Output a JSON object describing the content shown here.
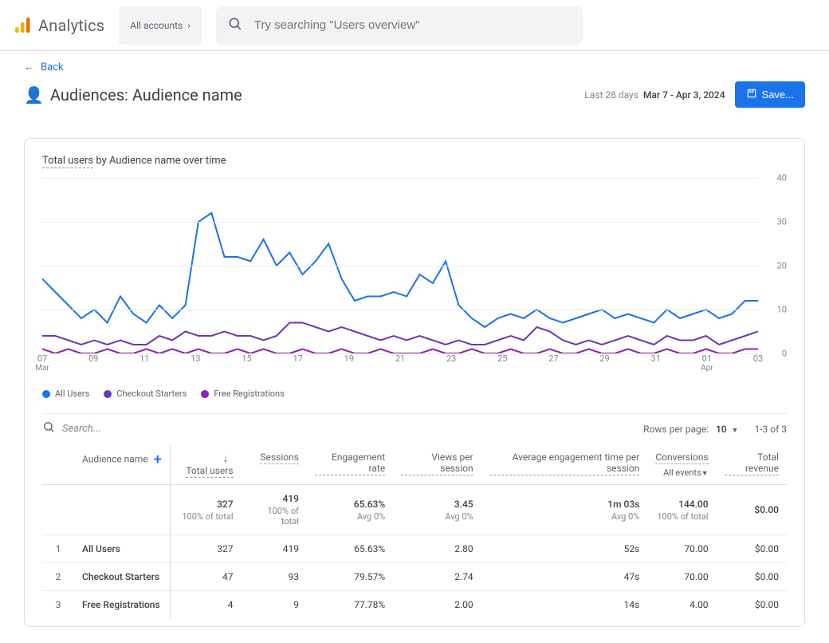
{
  "header": {
    "product": "Analytics",
    "account_chip": "All accounts",
    "search_placeholder": "Try searching \"Users overview\""
  },
  "nav": {
    "back_label": "Back"
  },
  "page": {
    "title": "Audiences: Audience name",
    "date_prefix": "Last 28 days",
    "date_range": "Mar 7 - Apr 3, 2024",
    "save_label": "Save..."
  },
  "card": {
    "title_a": "Total users",
    "title_b": " by Audience name over time"
  },
  "chart_data": {
    "type": "line",
    "ylim": [
      0,
      40
    ],
    "y_ticks": [
      0,
      10,
      20,
      30,
      40
    ],
    "x_ticks": [
      "07",
      "09",
      "11",
      "13",
      "15",
      "17",
      "19",
      "21",
      "23",
      "25",
      "27",
      "29",
      "31",
      "01",
      "03"
    ],
    "x_sub_left": "Mar",
    "x_sub_right": "Apr",
    "x_sub_right_idx": 13,
    "series": [
      {
        "name": "All Users",
        "color": "#1a73e8",
        "values": [
          17,
          14,
          11,
          8,
          10,
          7,
          13,
          9,
          7,
          11,
          8,
          11,
          30,
          32,
          22,
          22,
          21,
          26,
          20,
          23,
          18,
          21,
          25,
          17,
          12,
          13,
          13,
          14,
          13,
          18,
          16,
          21,
          11,
          8,
          6,
          8,
          9,
          8,
          10,
          8,
          7,
          8,
          9,
          10,
          8,
          9,
          8,
          7,
          10,
          8,
          9,
          10,
          8,
          9,
          12,
          12
        ]
      },
      {
        "name": "Checkout Starters",
        "color": "#673ab7",
        "values": [
          4,
          4,
          3,
          2,
          3,
          2,
          3,
          2,
          2,
          4,
          3,
          5,
          4,
          4,
          5,
          4,
          4,
          3,
          4,
          7,
          7,
          6,
          5,
          6,
          5,
          4,
          3,
          4,
          3,
          4,
          3,
          2,
          3,
          2,
          2,
          3,
          4,
          3,
          6,
          5,
          3,
          2,
          3,
          2,
          3,
          4,
          3,
          2,
          4,
          3,
          3,
          4,
          2,
          3,
          4,
          5
        ]
      },
      {
        "name": "Free Registrations",
        "color": "#8e24aa",
        "values": [
          1,
          0,
          1,
          0,
          0,
          1,
          0,
          0,
          1,
          0,
          1,
          0,
          1,
          0,
          0,
          1,
          0,
          1,
          0,
          0,
          1,
          0,
          0,
          1,
          0,
          0,
          1,
          0,
          0,
          0,
          1,
          0,
          0,
          1,
          0,
          0,
          1,
          0,
          0,
          1,
          0,
          0,
          1,
          0,
          0,
          1,
          0,
          0,
          1,
          0,
          0,
          1,
          0,
          0,
          1,
          1
        ]
      }
    ]
  },
  "table_controls": {
    "search_placeholder": "Search...",
    "rows_per_page_label": "Rows per page:",
    "rows_per_page_value": "10",
    "range_label": "1-3 of 3"
  },
  "table": {
    "columns": {
      "name": "Audience name",
      "total_users": "Total users",
      "sessions": "Sessions",
      "engagement_rate": "Engagement rate",
      "views_per_session": "Views per session",
      "avg_engagement": "Average engagement time per session",
      "conversions": "Conversions",
      "conversions_sub": "All events",
      "total_revenue": "Total revenue"
    },
    "totals": {
      "total_users": "327",
      "total_users_sub": "100% of total",
      "sessions": "419",
      "sessions_sub": "100% of total",
      "engagement_rate": "65.63%",
      "engagement_rate_sub": "Avg 0%",
      "views_per_session": "3.45",
      "views_per_session_sub": "Avg 0%",
      "avg_engagement": "1m 03s",
      "avg_engagement_sub": "Avg 0%",
      "conversions": "144.00",
      "conversions_sub": "100% of total",
      "total_revenue": "$0.00"
    },
    "rows": [
      {
        "idx": "1",
        "name": "All Users",
        "total_users": "327",
        "sessions": "419",
        "engagement_rate": "65.63%",
        "views_per_session": "2.80",
        "avg_engagement": "52s",
        "conversions": "70.00",
        "total_revenue": "$0.00"
      },
      {
        "idx": "2",
        "name": "Checkout Starters",
        "total_users": "47",
        "sessions": "93",
        "engagement_rate": "79.57%",
        "views_per_session": "2.74",
        "avg_engagement": "47s",
        "conversions": "70.00",
        "total_revenue": "$0.00"
      },
      {
        "idx": "3",
        "name": "Free Registrations",
        "total_users": "4",
        "sessions": "9",
        "engagement_rate": "77.78%",
        "views_per_session": "2.00",
        "avg_engagement": "14s",
        "conversions": "4.00",
        "total_revenue": "$0.00"
      }
    ]
  }
}
